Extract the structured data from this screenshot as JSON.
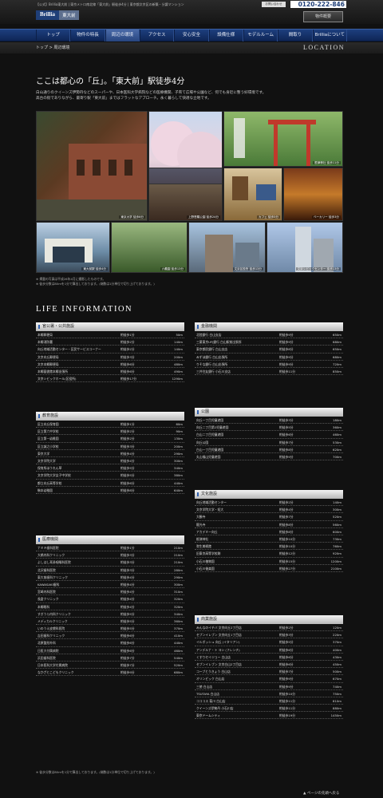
{
  "header": {
    "page_title": "【公式】Brillia東大前 | 東京メトロ南北線「東大前」駅徒歩4分 | 東京都文京区の新築・分譲マンション",
    "logo_brand": "Brillia",
    "logo_name": "東大前",
    "contact_label": "お問い合わせ",
    "tel": "0120-222-846",
    "outline_button": "物件概要"
  },
  "nav": [
    "トップ",
    "物件の特長",
    "周辺の環境",
    "アクセス",
    "安心安全",
    "設備仕様",
    "モデルルーム",
    "間取り",
    "Brilliaについて"
  ],
  "breadcrumb": "トップ > 周辺環境",
  "location_label": "LOCATION",
  "heading": "ここは都心の「丘」。「東大前」駅徒歩4分",
  "intro": [
    "白山通りのクイーンズ伊勢丹などのスーパーや、日本医科大学病院などの医療機関、子育て広場や公園など、何でも身近に整う好環境です。",
    "高台の街でありながら、最寄り駅「東大前」まではフラットなアプローチ。永く暮らして快適な立地です。"
  ],
  "photos": [
    {
      "caption": "東京大学 徒歩6分"
    },
    {
      "caption": "播磨坂の桜 徒歩14分"
    },
    {
      "caption": "根津神社 徒歩11分"
    },
    {
      "caption": "東京大学 徒歩4分"
    },
    {
      "caption": "上野恩賜公園 徒歩24分"
    },
    {
      "caption": "カフェ 徒歩5分"
    },
    {
      "caption": "ベーカリー 徒歩3分"
    },
    {
      "caption": "東大前駅 徒歩4分"
    },
    {
      "caption": "六義園 徒歩13分"
    },
    {
      "caption": "文京区役所 徒歩13分"
    },
    {
      "caption": "日本医科大学付属病院 徒歩7分"
    },
    {
      "caption": "文京シビックセンター 徒歩13分"
    }
  ],
  "notes": [
    "※ 掲載の写真は平成26年4月に撮影したものです。",
    "※ 徒歩分数は80mを1分で算出しております。(端数は1分単位で切り上げております。)"
  ],
  "life_title": "LIFE INFORMATION",
  "sections": {
    "public": {
      "title": "官公署・公共施設",
      "rows": [
        [
          "本郷郵便局",
          "約徒歩1分",
          "50m"
        ],
        [
          "本郷消防署",
          "約徒歩2分",
          "140m"
        ],
        [
          "向丘地域活動センター・区民サービスコーナー",
          "約徒歩2分",
          "140m"
        ],
        [
          "文京向丘郵便局",
          "約徒歩3分",
          "200m"
        ],
        [
          "文京本郷郵便局",
          "約徒歩6分",
          "480m"
        ],
        [
          "本郷図書館本郷出張所",
          "約徒歩6分",
          "490m"
        ],
        [
          "文京シビックホール(区役所)",
          "約徒歩17分",
          "1290m"
        ]
      ]
    },
    "education": {
      "title": "教育施設",
      "rows": [
        [
          "区立向丘保育園",
          "約徒歩1分",
          "60m"
        ],
        [
          "区立第六中学校",
          "約徒歩2分",
          "90m"
        ],
        [
          "区立第一幼稚園",
          "約徒歩2分",
          "130m"
        ],
        [
          "区立誠之小学校",
          "約徒歩3分",
          "200m"
        ],
        [
          "東京大学",
          "約徒歩4分",
          "290m"
        ],
        [
          "文京学院大学",
          "約徒歩4分",
          "300m"
        ],
        [
          "保育所ほうれん草",
          "約徒歩5分",
          "340m"
        ],
        [
          "文京学院大学女子中学校",
          "約徒歩5分",
          "380m"
        ],
        [
          "都立向丘高等学校",
          "約徒歩6分",
          "440m"
        ],
        [
          "駒本幼稚園",
          "約徒歩8分",
          "640m"
        ]
      ]
    },
    "medical": {
      "title": "医療機関",
      "rows": [
        [
          "ナミキ歯科医院",
          "約徒歩1分",
          "210m"
        ],
        [
          "大橋内科クリニック",
          "約徒歩3分",
          "210m"
        ],
        [
          "よしはし耳鼻咽喉科医院",
          "約徒歩3分",
          "210m"
        ],
        [
          "北沢歯科医院",
          "約徒歩3分",
          "280m"
        ],
        [
          "東大前歯科クリニック",
          "約徒歩4分",
          "290m"
        ],
        [
          "KAWASAKI歯科",
          "約徒歩4分",
          "300m"
        ],
        [
          "宮崎内科医院",
          "約徒歩4分",
          "310m"
        ],
        [
          "長倉クリニック",
          "約徒歩4分",
          "320m"
        ],
        [
          "本郷眼科",
          "約徒歩4分",
          "320m"
        ],
        [
          "すぎうら内科クリニック",
          "約徒歩5分",
          "340m"
        ],
        [
          "メディカルクリニック",
          "約徒歩5分",
          "360m"
        ],
        [
          "いのうえ皮膚科医院",
          "約徒歩5分",
          "370m"
        ],
        [
          "吉田歯科クリニック",
          "約徒歩6分",
          "410m"
        ],
        [
          "北原整形外科",
          "約徒歩6分",
          "440m"
        ],
        [
          "日医大付属病院",
          "約徒歩6分",
          "460m"
        ],
        [
          "浜田歯科医院",
          "約徒歩7分",
          "540m"
        ],
        [
          "日本医科大学付属病院",
          "約徒歩7分",
          "520m"
        ],
        [
          "なかざとこどもクリニック",
          "約徒歩9分",
          "680m"
        ]
      ]
    },
    "finance": {
      "title": "金融機関",
      "rows": [
        [
          "北陸銀行 白山支店",
          "約徒歩9分",
          "650m"
        ],
        [
          "三菱東京UFJ銀行 白山駅前出張所",
          "約徒歩9分",
          "680m"
        ],
        [
          "東京都民銀行 白山支店",
          "約徒歩8分",
          "650m"
        ],
        [
          "みずほ銀行 白山出張所",
          "約徒歩9分",
          "680m"
        ],
        [
          "りそな銀行 白山出張所",
          "約徒歩9分",
          "720m"
        ],
        [
          "三井住友銀行 小石川支店",
          "約徒歩11分",
          "850m"
        ]
      ]
    },
    "park": {
      "title": "公園",
      "rows": [
        [
          "向丘一丁目児童遊園",
          "約徒歩3分",
          "180m"
        ],
        [
          "向丘二丁目第2児童遊園",
          "約徒歩5分",
          "360m"
        ],
        [
          "白山二丁目児童遊園",
          "約徒歩6分",
          "460m"
        ],
        [
          "向丘公園",
          "約徒歩7分",
          "530m"
        ],
        [
          "白山一丁目児童遊園",
          "約徒歩8分",
          "620m"
        ],
        [
          "丸山福山児童遊園",
          "約徒歩9分",
          "700m"
        ]
      ]
    },
    "culture": {
      "title": "文化施設",
      "rows": [
        [
          "向丘地域活動センター",
          "約徒歩2分",
          "140m"
        ],
        [
          "文京学院大学・短大",
          "約徒歩4分",
          "300m"
        ],
        [
          "大観寺",
          "約徒歩7分",
          "520m"
        ],
        [
          "龍光寺",
          "約徒歩8分",
          "560m"
        ],
        [
          "アカデミー向丘",
          "約徒歩8分",
          "600m"
        ],
        [
          "根津神社",
          "約徒歩10分",
          "730m"
        ],
        [
          "弥生美術館",
          "約徒歩10分",
          "760m"
        ],
        [
          "旧東京高等学校跡",
          "約徒歩12分",
          "920m"
        ],
        [
          "小石川植物園",
          "約徒歩15分",
          "1200m"
        ],
        [
          "小石川後楽園",
          "約徒歩27分",
          "2100m"
        ]
      ]
    },
    "shopping": {
      "title": "商業施設",
      "rows": [
        [
          "みんなのイチバ 文京向丘2丁目店",
          "約徒歩2分",
          "120m"
        ],
        [
          "セブンイレブン 文京向丘1丁目店",
          "約徒歩3分",
          "220m"
        ],
        [
          "イルボッシュ 向丘 (イタリアン)",
          "約徒歩5分",
          "370m"
        ],
        [
          "アンデルナ・ト ヨシ (フレンチ)",
          "約徒歩6分",
          "400m"
        ],
        [
          "くすりセイジョー 白山店",
          "約徒歩6分",
          "430m"
        ],
        [
          "セブンイレブン 文京白山2丁目店",
          "約徒歩6分",
          "450m"
        ],
        [
          "コープとうきょう 白山店",
          "約徒歩7分",
          "500m"
        ],
        [
          "オリンピック 白山店",
          "約徒歩9分",
          "670m"
        ],
        [
          "三徳 白山店",
          "約徒歩9分",
          "740m"
        ],
        [
          "TSUTAYA 白山店",
          "約徒歩10分",
          "750m"
        ],
        [
          "コココス 菊川 白山店",
          "約徒歩11分",
          "810m"
        ],
        [
          "クイーンズ伊勢丹 小石川店",
          "約徒歩11分",
          "880m"
        ],
        [
          "東京ドームシティ",
          "約徒歩19分",
          "1450m"
        ]
      ]
    }
  },
  "footnote": "※ 徒歩分数は80mを1分で算出しております。(端数は1分単位で切り上げております。)",
  "pagetop": "ページの先頭へ戻る"
}
